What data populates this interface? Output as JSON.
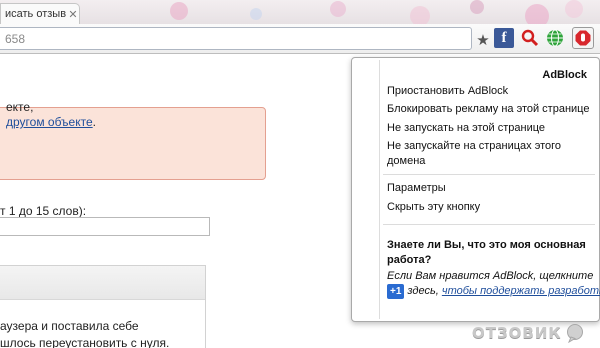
{
  "tab": {
    "title": "исать отзыв",
    "close_icon": "close-icon"
  },
  "toolbar": {
    "url_text": "658"
  },
  "page": {
    "alert_line1": "екте,",
    "alert_link": "другом объекте",
    "alert_line2_end": ".",
    "words_label": "т 1 до 15 слов):",
    "body_line1": "аузера и поставила себе",
    "body_line2": "шлось переустановить с нуля."
  },
  "adblock_menu": {
    "title": "AdBlock",
    "items": [
      "Приостановить AdBlock",
      "Блокировать рекламу на этой странице",
      "Не запускать на этой странице",
      "Не запускайте на страницах этого домена",
      "Параметры",
      "Скрыть эту кнопку"
    ],
    "info_heading": "Знаете ли Вы, что это моя основная работа?",
    "info_line1": "Если Вам нравится AdBlock, щелкните",
    "gplus_label": "+1",
    "info_line2_mid": "здесь, ",
    "info_link": "чтобы поддержать разработку",
    "info_end": "!"
  },
  "watermark": {
    "text": "ОТЗОВИК"
  },
  "colors": {
    "alert_bg": "#fbe3d9",
    "alert_border": "#e4a090",
    "link": "#1f4e9b",
    "adblock_red": "#d8272d",
    "facebook": "#3b5998"
  }
}
